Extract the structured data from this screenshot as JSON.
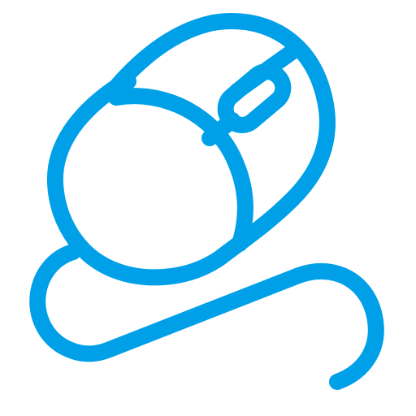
{
  "icon": {
    "name": "computer-mouse-icon",
    "stroke_color": "#00a0e9",
    "background_color": "#ffffff"
  }
}
